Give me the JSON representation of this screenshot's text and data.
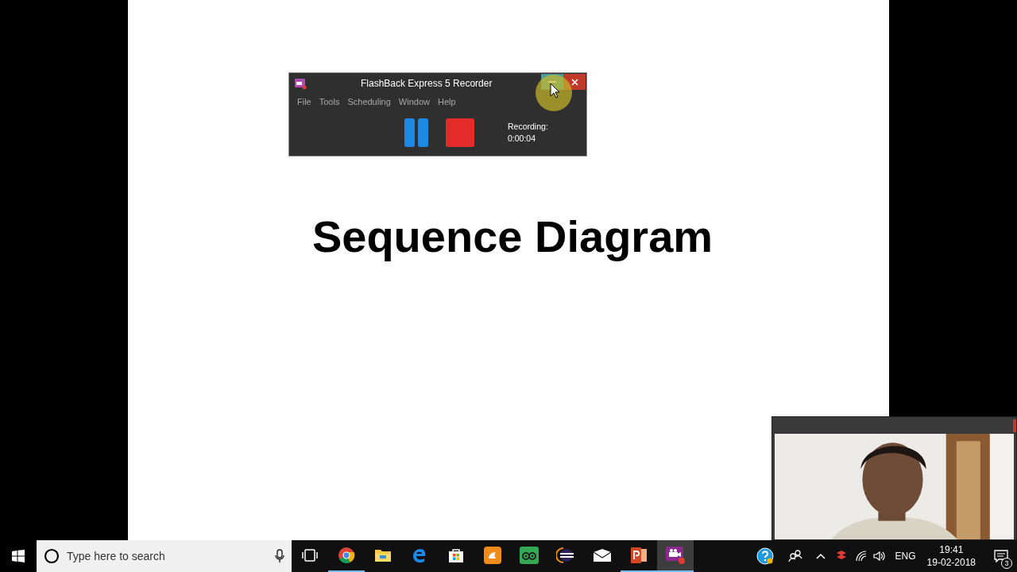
{
  "slide": {
    "title": "Sequence Diagram"
  },
  "recorder": {
    "title": "FlashBack Express 5 Recorder",
    "menu": [
      "File",
      "Tools",
      "Scheduling",
      "Window",
      "Help"
    ],
    "status_label": "Recording:",
    "elapsed": "0:00:04"
  },
  "taskbar": {
    "search": {
      "placeholder": "Type here to search"
    },
    "apps": [
      {
        "kind": "taskview",
        "running": false,
        "selected": false
      },
      {
        "kind": "chrome",
        "running": true,
        "selected": false
      },
      {
        "kind": "explorer",
        "running": false,
        "selected": false
      },
      {
        "kind": "edge",
        "running": false,
        "selected": false
      },
      {
        "kind": "store",
        "running": false,
        "selected": false
      },
      {
        "kind": "uc",
        "running": false,
        "selected": false
      },
      {
        "kind": "owl",
        "running": false,
        "selected": false
      },
      {
        "kind": "eclipse",
        "running": false,
        "selected": false
      },
      {
        "kind": "mail",
        "running": false,
        "selected": false
      },
      {
        "kind": "powerpoint",
        "running": true,
        "selected": false
      },
      {
        "kind": "recorder",
        "running": true,
        "selected": true
      }
    ],
    "language": "ENG",
    "time": "19:41",
    "date": "19-02-2018",
    "notifications": "3"
  }
}
